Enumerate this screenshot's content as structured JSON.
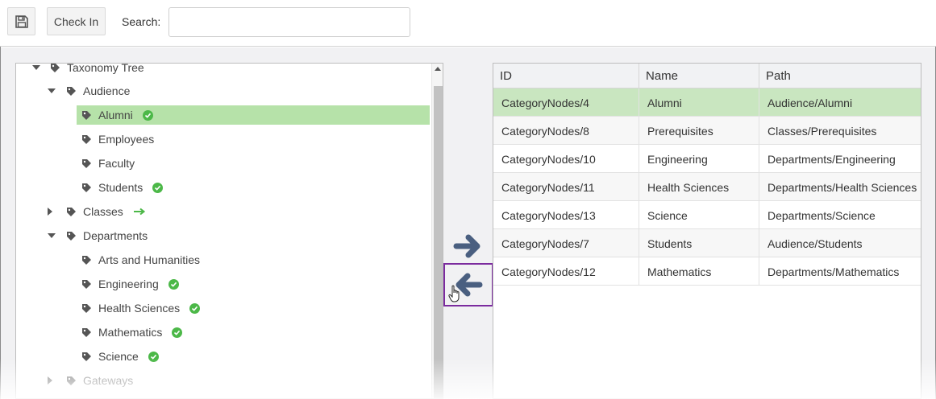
{
  "toolbar": {
    "save_icon": "floppy-disk-icon",
    "checkin_label": "Check In",
    "search_label": "Search:",
    "search_value": "",
    "search_placeholder": ""
  },
  "tree": {
    "root": {
      "label": "Taxonomy Tree"
    },
    "audience": {
      "label": "Audience",
      "children": [
        {
          "label": "Alumni",
          "status": "check"
        },
        {
          "label": "Employees"
        },
        {
          "label": "Faculty"
        },
        {
          "label": "Students",
          "status": "check"
        }
      ]
    },
    "classes": {
      "label": "Classes",
      "status": "arrow"
    },
    "departments": {
      "label": "Departments",
      "children": [
        {
          "label": "Arts and Humanities"
        },
        {
          "label": "Engineering",
          "status": "check"
        },
        {
          "label": "Health Sciences",
          "status": "check"
        },
        {
          "label": "Mathematics",
          "status": "check"
        },
        {
          "label": "Science",
          "status": "check"
        }
      ]
    },
    "gateways": {
      "label": "Gateways"
    }
  },
  "grid": {
    "columns": [
      "ID",
      "Name",
      "Path"
    ],
    "rows": [
      [
        "CategoryNodes/4",
        "Alumni",
        "Audience/Alumni"
      ],
      [
        "CategoryNodes/8",
        "Prerequisites",
        "Classes/Prerequisites"
      ],
      [
        "CategoryNodes/10",
        "Engineering",
        "Departments/Engineering"
      ],
      [
        "CategoryNodes/11",
        "Health Sciences",
        "Departments/Health Sciences"
      ],
      [
        "CategoryNodes/13",
        "Science",
        "Departments/Science"
      ],
      [
        "CategoryNodes/7",
        "Students",
        "Audience/Students"
      ],
      [
        "CategoryNodes/12",
        "Mathematics",
        "Departments/Mathematics"
      ]
    ]
  },
  "colors": {
    "selected_tree": "#b6e2a9",
    "selected_row": "#c9e6c0",
    "status_green": "#4cb848",
    "move_arrow": "#4a5f80",
    "focus_border": "#7b2b9e"
  }
}
